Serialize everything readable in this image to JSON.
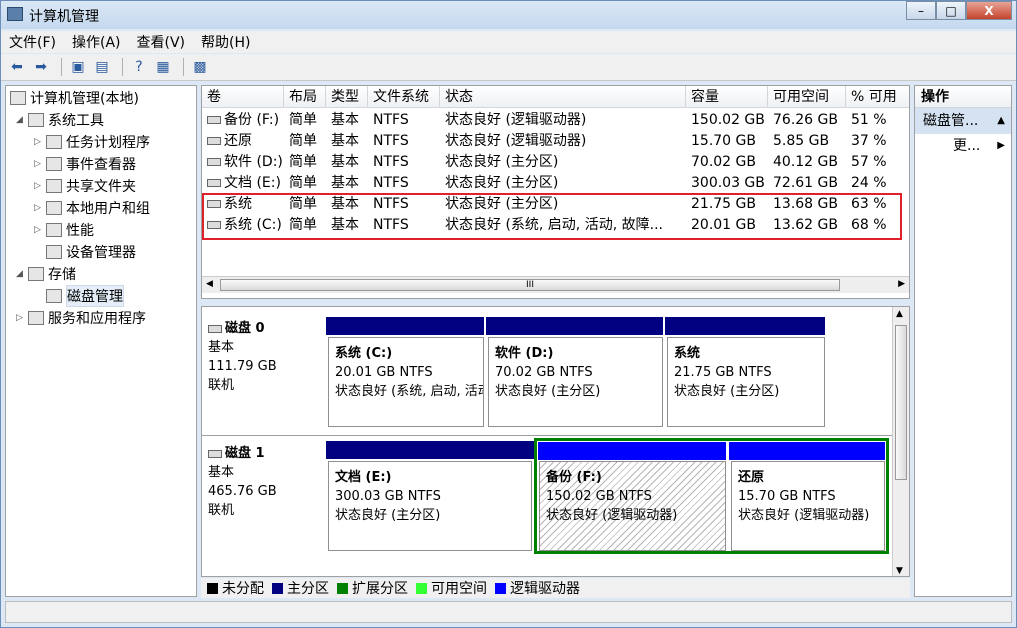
{
  "window": {
    "title": "计算机管理",
    "buttons": {
      "minimize": "–",
      "maximize": "□",
      "close": "X"
    }
  },
  "menu": [
    "文件(F)",
    "操作(A)",
    "查看(V)",
    "帮助(H)"
  ],
  "tree": [
    {
      "label": "计算机管理(本地)",
      "level": 0,
      "exp": ""
    },
    {
      "label": "系统工具",
      "level": 1,
      "exp": "◢"
    },
    {
      "label": "任务计划程序",
      "level": 2,
      "exp": "▷"
    },
    {
      "label": "事件查看器",
      "level": 2,
      "exp": "▷"
    },
    {
      "label": "共享文件夹",
      "level": 2,
      "exp": "▷"
    },
    {
      "label": "本地用户和组",
      "level": 2,
      "exp": "▷"
    },
    {
      "label": "性能",
      "level": 2,
      "exp": "▷"
    },
    {
      "label": "设备管理器",
      "level": 2,
      "exp": ""
    },
    {
      "label": "存储",
      "level": 1,
      "exp": "◢"
    },
    {
      "label": "磁盘管理",
      "level": 2,
      "exp": ""
    },
    {
      "label": "服务和应用程序",
      "level": 1,
      "exp": "▷"
    }
  ],
  "columns": [
    "卷",
    "布局",
    "类型",
    "文件系统",
    "状态",
    "容量",
    "可用空间",
    "% 可用"
  ],
  "volumes": [
    [
      "备份 (F:)",
      "简单",
      "基本",
      "NTFS",
      "状态良好 (逻辑驱动器)",
      "150.02 GB",
      "76.26 GB",
      "51 %"
    ],
    [
      "还原",
      "简单",
      "基本",
      "NTFS",
      "状态良好 (逻辑驱动器)",
      "15.70 GB",
      "5.85 GB",
      "37 %"
    ],
    [
      "软件 (D:)",
      "简单",
      "基本",
      "NTFS",
      "状态良好 (主分区)",
      "70.02 GB",
      "40.12 GB",
      "57 %"
    ],
    [
      "文档 (E:)",
      "简单",
      "基本",
      "NTFS",
      "状态良好 (主分区)",
      "300.03 GB",
      "72.61 GB",
      "24 %"
    ],
    [
      "系统",
      "简单",
      "基本",
      "NTFS",
      "状态良好 (主分区)",
      "21.75 GB",
      "13.68 GB",
      "63 %"
    ],
    [
      "系统 (C:)",
      "简单",
      "基本",
      "NTFS",
      "状态良好 (系统, 启动, 活动, 故障...",
      "20.01 GB",
      "13.62 GB",
      "68 %"
    ]
  ],
  "disks": [
    {
      "name": "磁盘 0",
      "type": "基本",
      "size": "111.79 GB",
      "status": "联机",
      "parts": [
        {
          "name": "系统  (C:)",
          "size": "20.01 GB NTFS",
          "status": "状态良好 (系统, 启动, 活动, 故障转储, 主分区)"
        },
        {
          "name": "软件  (D:)",
          "size": "70.02 GB NTFS",
          "status": "状态良好 (主分区)"
        },
        {
          "name": "系统",
          "size": "21.75 GB NTFS",
          "status": "状态良好 (主分区)"
        }
      ]
    },
    {
      "name": "磁盘 1",
      "type": "基本",
      "size": "465.76 GB",
      "status": "联机",
      "parts": [
        {
          "name": "文档  (E:)",
          "size": "300.03 GB NTFS",
          "status": "状态良好 (主分区)"
        },
        {
          "name": "备份  (F:)",
          "size": "150.02 GB NTFS",
          "status": "状态良好 (逻辑驱动器)"
        },
        {
          "name": "还原",
          "size": "15.70 GB NTFS",
          "status": "状态良好 (逻辑驱动器)"
        }
      ]
    }
  ],
  "legend": [
    {
      "label": "未分配",
      "color": "#000000"
    },
    {
      "label": "主分区",
      "color": "#000080"
    },
    {
      "label": "扩展分区",
      "color": "#008000"
    },
    {
      "label": "可用空间",
      "color": "#33ff33"
    },
    {
      "label": "逻辑驱动器",
      "color": "#0000ff"
    }
  ],
  "actions": {
    "header": "操作",
    "item": "磁盘管...",
    "more": "更..."
  }
}
